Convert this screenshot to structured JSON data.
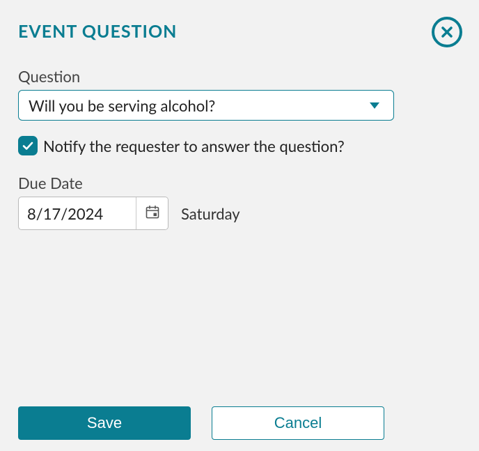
{
  "dialog": {
    "title": "EVENT QUESTION"
  },
  "question": {
    "label": "Question",
    "selected": "Will you be serving alcohol?"
  },
  "notify": {
    "label": "Notify the requester to answer the question?",
    "checked": true
  },
  "dueDate": {
    "label": "Due Date",
    "value": "8/17/2024",
    "dayOfWeek": "Saturday"
  },
  "buttons": {
    "save": "Save",
    "cancel": "Cancel"
  },
  "icons": {
    "close": "close-icon",
    "calendar": "calendar-icon",
    "checkmark": "checkmark-icon",
    "chevronDown": "chevron-down-icon"
  },
  "colors": {
    "accent": "#0a7d91",
    "bg": "#f2f2f2",
    "border": "#b9b9b9"
  }
}
